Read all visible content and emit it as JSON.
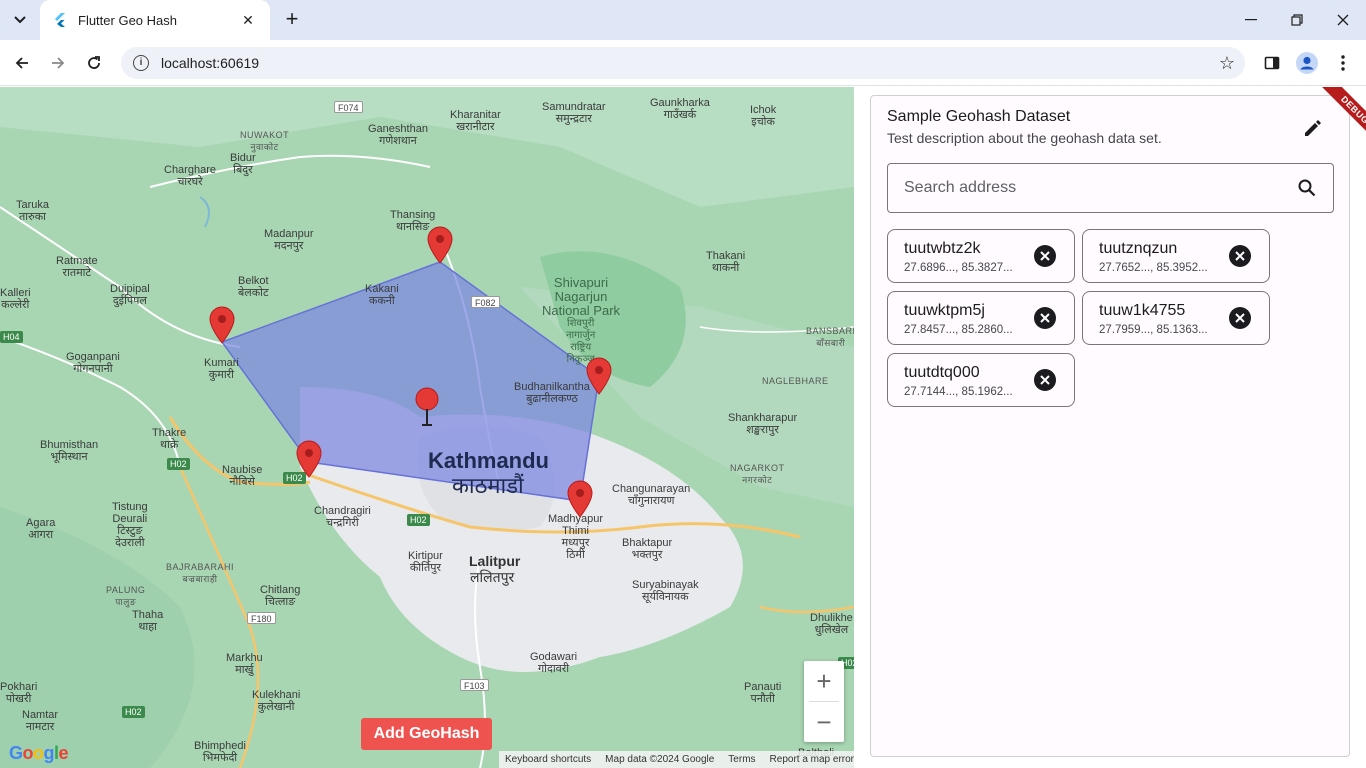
{
  "browser": {
    "tab_title": "Flutter Geo Hash",
    "url": "localhost:60619"
  },
  "map": {
    "labels": [
      {
        "id": "nuwakot",
        "text": "NUWAKOT\nनुवाकोट"
      },
      {
        "id": "ganeshthan",
        "text": "Ganeshthan\nगणेशथान"
      },
      {
        "id": "kharanitar",
        "text": "Kharanitar\nखरानीटार"
      },
      {
        "id": "samundratar",
        "text": "Samundratar\nसमुन्द्रटार"
      },
      {
        "id": "gaunkharka",
        "text": "Gaunkharka\nगाउँखर्क"
      },
      {
        "id": "ichok",
        "text": "Ichok\nइचोक"
      },
      {
        "id": "charghare",
        "text": "Charghare\nचारघरे"
      },
      {
        "id": "bidur",
        "text": "Bidur\nबिदुर"
      },
      {
        "id": "taruka",
        "text": "Taruka\nतारुका"
      },
      {
        "id": "thansing",
        "text": "Thansing\nथानसिङ"
      },
      {
        "id": "madanpur",
        "text": "Madanpur\nमदनपुर"
      },
      {
        "id": "ratmate",
        "text": "Ratmate\nरातमाटे"
      },
      {
        "id": "dupipal",
        "text": "Duipipal\nदुईपिपल"
      },
      {
        "id": "belkot",
        "text": "Belkot\nबेलकोट"
      },
      {
        "id": "kakani",
        "text": "Kakani\nककनी"
      },
      {
        "id": "thakani",
        "text": "Thakani\nथाकनी"
      },
      {
        "id": "kalleri",
        "text": "Kalleri\nकल्लेरी"
      },
      {
        "id": "goganpani",
        "text": "Goganpani\nगोगनपानी"
      },
      {
        "id": "kumari",
        "text": "Kumari\nकुमारी"
      },
      {
        "id": "budhanilkantha",
        "text": "Budhanilkantha\nबुढानीलकण्ठ"
      },
      {
        "id": "bansbari",
        "text": "BANSBARI\nबाँसबारी"
      },
      {
        "id": "naglebhare",
        "text": "NAGLEBHARE"
      },
      {
        "id": "shankharapur",
        "text": "Shankharapur\nशङ्खरापुर"
      },
      {
        "id": "thakre",
        "text": "Thakre\nथाक्रे"
      },
      {
        "id": "bhumisthan",
        "text": "Bhumisthan\nभूमिस्थान"
      },
      {
        "id": "naubise",
        "text": "Naubise\nनौबिसे"
      },
      {
        "id": "nagarkot",
        "text": "NAGARKOT\nनगरकोट"
      },
      {
        "id": "changunarayan",
        "text": "Changunarayan\nचाँगुनारायण"
      },
      {
        "id": "tistung",
        "text": "Tistung\nDeurali\nटिस्टुङ\nदेउराली"
      },
      {
        "id": "chandragiri",
        "text": "Chandragiri\nचन्द्रगिरी"
      },
      {
        "id": "madhyapur",
        "text": "Madhyapur\nThimi\nमध्यपुर\nठिमी"
      },
      {
        "id": "bhaktapur",
        "text": "Bhaktapur\nभक्तपुर"
      },
      {
        "id": "agara",
        "text": "Agara\nआगरा"
      },
      {
        "id": "bajrabarahi",
        "text": "BAJRABARAHI\nबज्रबाराही"
      },
      {
        "id": "kirtipur",
        "text": "Kirtipur\nकीर्तिपुर"
      },
      {
        "id": "palung",
        "text": "PALUNG\nपालुङ"
      },
      {
        "id": "chitlang",
        "text": "Chitlang\nचित्लाङ"
      },
      {
        "id": "suryabinayak",
        "text": "Suryabinayak\nसूर्यविनायक"
      },
      {
        "id": "thaha",
        "text": "Thaha\nथाहा"
      },
      {
        "id": "dhulikhel",
        "text": "Dhulikhe\nधुलिखेल"
      },
      {
        "id": "godawari",
        "text": "Godawari\nगोदावरी"
      },
      {
        "id": "markhu",
        "text": "Markhu\nमार्खु"
      },
      {
        "id": "panauti",
        "text": "Panauti\nपनौती"
      },
      {
        "id": "pokhari",
        "text": "Pokhari\nपोखरी"
      },
      {
        "id": "kulekhani",
        "text": "Kulekhani\nकुलेखानी"
      },
      {
        "id": "namtar",
        "text": "Namtar\nनामटार"
      },
      {
        "id": "bhimphedi",
        "text": "Bhimphedi\nभिमफेदी"
      },
      {
        "id": "balthali",
        "text": "Balthali"
      }
    ],
    "city_kathmandu": "Kathmandu",
    "city_kathmandu_np": "काठमाडौं",
    "city_lalitpur": "Lalitpur",
    "city_lalitpur_np": "ललितपुर",
    "park": "Shivapuri\nNagarjun\nNational Park",
    "park_np": "शिवपुरी\nनागार्जुन\nराष्ट्रिय\nनिकुञ्ज",
    "road_badges": [
      "F074",
      "F082",
      "H04",
      "H02",
      "H02",
      "H02",
      "F180",
      "F103",
      "H02",
      "H02"
    ],
    "zoom_in": "+",
    "zoom_out": "−",
    "add_button": "Add GeoHash",
    "google": "Google",
    "attribution": {
      "shortcuts": "Keyboard shortcuts",
      "data": "Map data ©2024 Google",
      "terms": "Terms",
      "report": "Report a map error"
    },
    "polygon_color": "#7b86e0",
    "pin_color": "#e53935"
  },
  "panel": {
    "title": "Sample Geohash Dataset",
    "description": "Test description about the geohash data set.",
    "search_placeholder": "Search address",
    "debug": "DEBUG",
    "chips": [
      {
        "hash": "tuutwbtz2k",
        "coords": "27.6896..., 85.3827..."
      },
      {
        "hash": "tuutznqzun",
        "coords": "27.7652..., 85.3952..."
      },
      {
        "hash": "tuuwktpm5j",
        "coords": "27.8457..., 85.2860..."
      },
      {
        "hash": "tuuw1k4755",
        "coords": "27.7959..., 85.1363..."
      },
      {
        "hash": "tuutdtq000",
        "coords": "27.7144..., 85.1962..."
      }
    ]
  }
}
